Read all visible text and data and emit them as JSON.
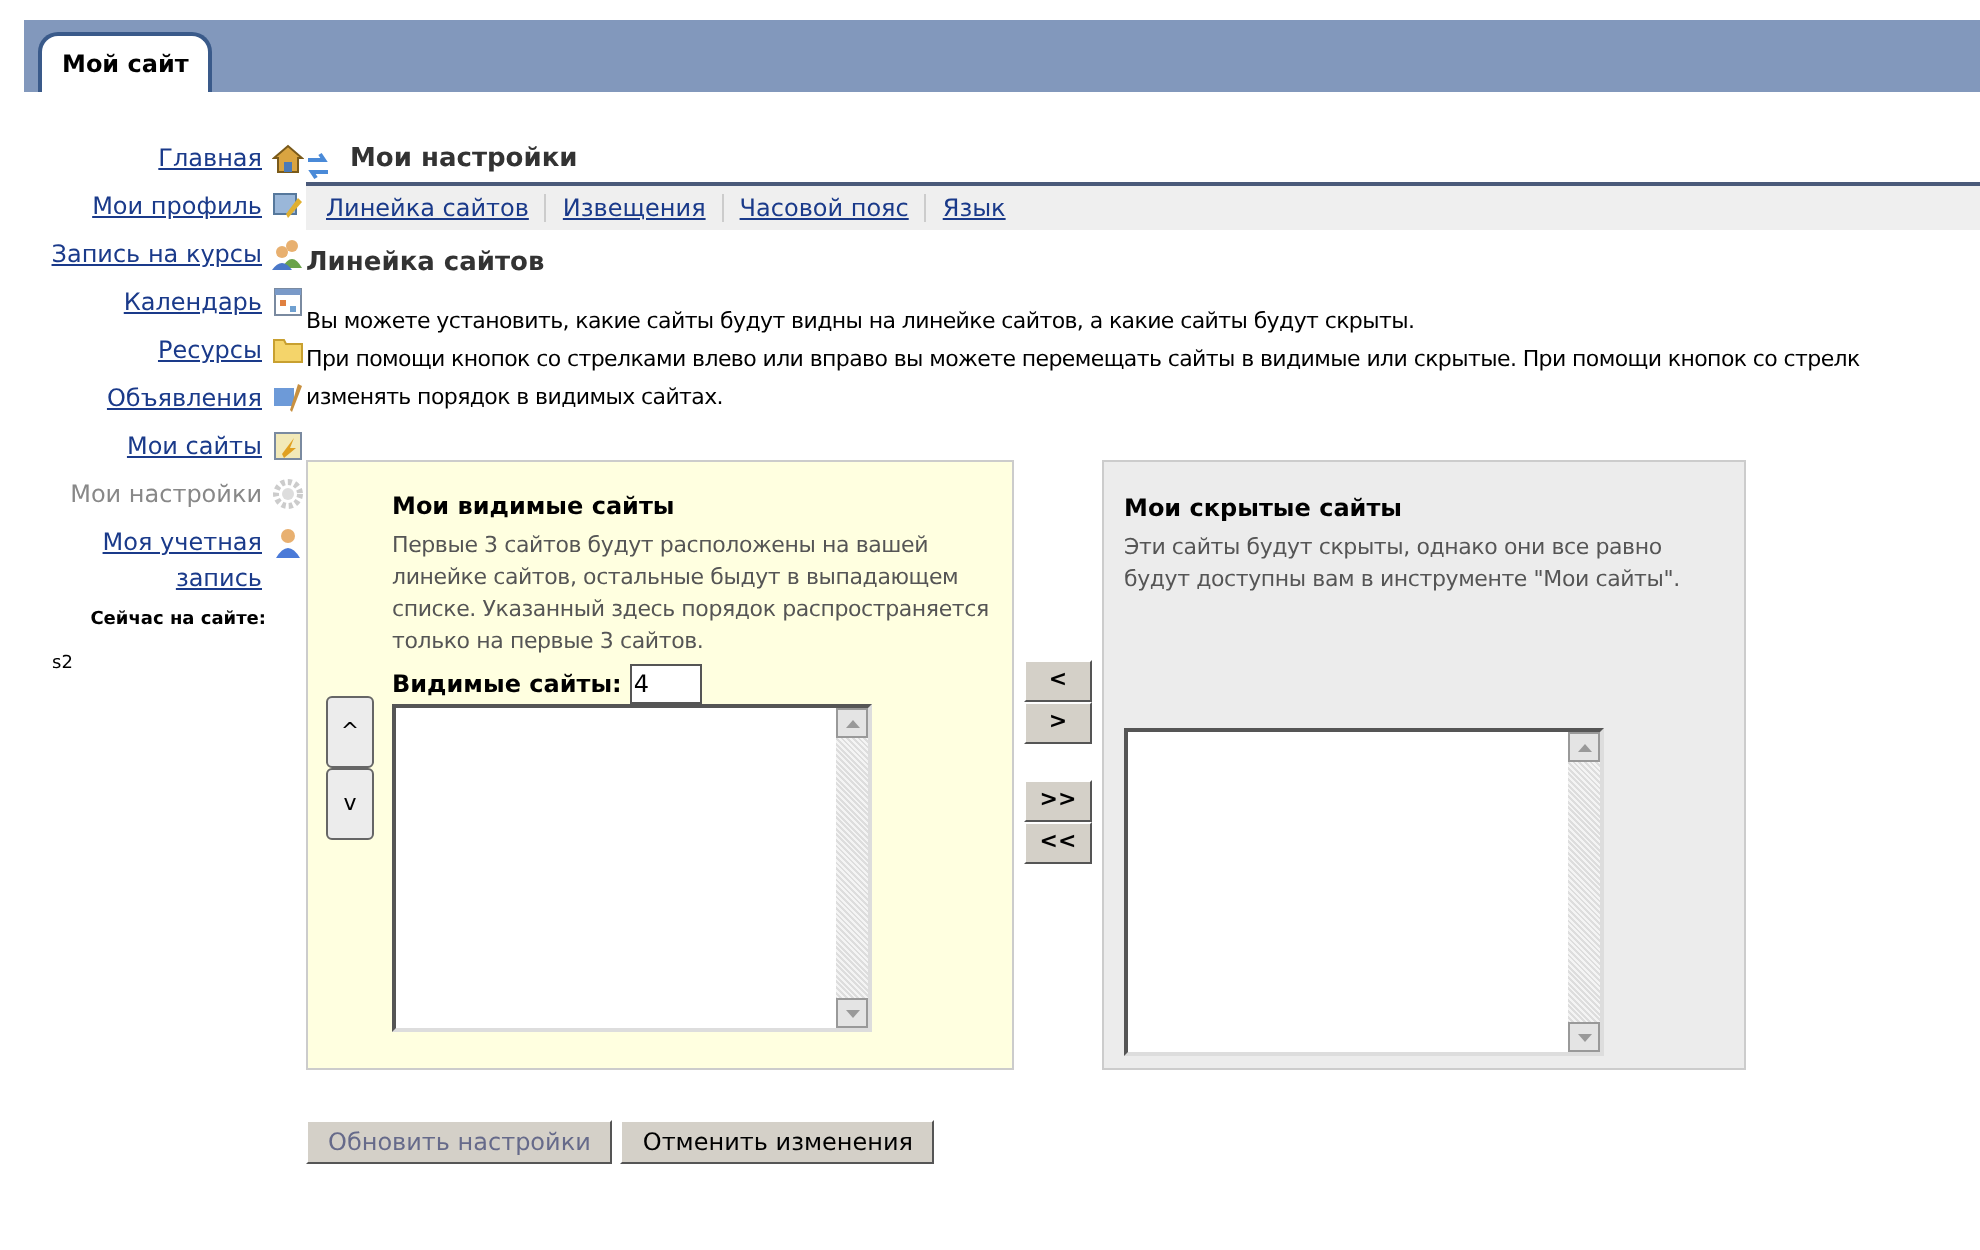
{
  "top_tab": {
    "label": "Мой сайт",
    "selected": true
  },
  "sidebar": {
    "items": [
      {
        "label": "Главная",
        "kind": "home",
        "selected": false
      },
      {
        "label": "Мои профиль",
        "kind": "profile",
        "selected": false
      },
      {
        "label": "Запись на курсы",
        "kind": "people",
        "selected": false
      },
      {
        "label": "Календарь",
        "kind": "calendar",
        "selected": false
      },
      {
        "label": "Ресурсы",
        "kind": "folder",
        "selected": false
      },
      {
        "label": "Объявления",
        "kind": "announce",
        "selected": false
      },
      {
        "label": "Мои сайты",
        "kind": "sites",
        "selected": false
      },
      {
        "label": "Мои настройки",
        "kind": "gear",
        "selected": true
      },
      {
        "label": "Моя учетная запись",
        "kind": "user",
        "selected": false
      }
    ],
    "online_label": "Сейчас на сайте:",
    "online_users": [
      "s2"
    ]
  },
  "page_title": "Мои настройки",
  "nav_tabs": [
    {
      "label": "Линейка сайтов"
    },
    {
      "label": "Извещения"
    },
    {
      "label": "Часовой пояс"
    },
    {
      "label": "Язык"
    }
  ],
  "section_title": "Линейка сайтов",
  "intro_lines": [
    "Вы можете установить, какие сайты будут видны на линейке сайтов, а какие сайты будут скрыты.",
    "При помощи кнопок со стрелками влево или вправо вы можете перемещать сайты в видимые или скрытые. При помощи кнопок со стрелк",
    "изменять порядок в видимых сайтах."
  ],
  "visible_panel": {
    "title": "Мои видимые сайты",
    "description": "Первые 3 сайтов будут расположены на вашей линейке сайтов, остальные быдут в выпадающем списке. Указанный здесь порядок распространяется только на первые 3 сайтов.",
    "count_label": "Видимые сайты:",
    "count_value": "4",
    "order_buttons": [
      "^",
      "v"
    ]
  },
  "move_buttons": [
    [
      "<",
      ">"
    ],
    [
      ">>",
      "<<"
    ]
  ],
  "hidden_panel": {
    "title": "Мои скрытые сайты",
    "description": "Эти сайты будут скрыты, однако они все равно будут доступны вам в инструменте \"Мои сайты\"."
  },
  "actions": [
    {
      "label": "Обновить настройки",
      "disabled": true
    },
    {
      "label": "Отменить изменения",
      "disabled": false
    }
  ]
}
